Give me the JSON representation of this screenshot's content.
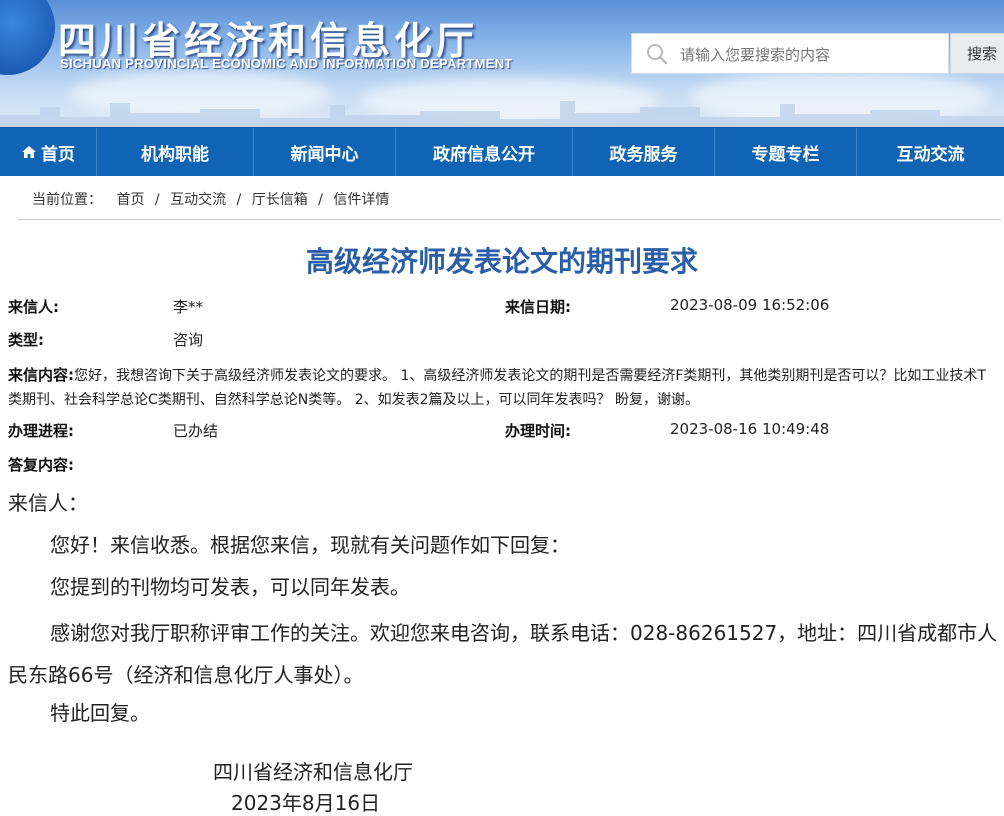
{
  "header": {
    "logo_cn": "四川省经济和信息化厅",
    "logo_en": "SICHUAN PROVINCIAL ECONOMIC AND INFORMATION DEPARTMENT",
    "search_placeholder": "请输入您要搜索的内容",
    "search_button": "搜索"
  },
  "nav": {
    "items": [
      "首页",
      "机构职能",
      "新闻中心",
      "政府信息公开",
      "政务服务",
      "专题专栏",
      "互动交流"
    ]
  },
  "breadcrumb": {
    "label": "当前位置：",
    "items": [
      "首页",
      "/",
      "互动交流",
      "/",
      "厅长信箱",
      "/",
      "信件详情"
    ]
  },
  "letter": {
    "title": "高级经济师发表论文的期刊要求",
    "sender_label": "来信人:",
    "sender": "李**",
    "date_label": "来信日期:",
    "date": "2023-08-09 16:52:06",
    "type_label": "类型:",
    "type": "咨询",
    "content_label": "来信内容:",
    "content": "您好，我想咨询下关于高级经济师发表论文的要求。 1、高级经济师发表论文的期刊是否需要经济F类期刊，其他类别期刊是否可以？比如工业技术T类期刊、社会科学总论C类期刊、自然科学总论N类等。 2、如发表2篇及以上，可以同年发表吗？ 盼复，谢谢。",
    "progress_label": "办理进程:",
    "progress": "已办结",
    "handle_time_label": "办理时间:",
    "handle_time": "2023-08-16 10:49:48",
    "reply_label": "答复内容:"
  },
  "reply": {
    "salutation": "来信人：",
    "p1": "您好！来信收悉。根据您来信，现就有关问题作如下回复：",
    "p2": "您提到的刊物均可发表，可以同年发表。",
    "p3": "感谢您对我厅职称评审工作的关注。欢迎您来电咨询，联系电话：028-86261527，地址：四川省成都市人民东路66号（经济和信息化厅人事处）。",
    "p4": "特此回复。",
    "signature": "四川省经济和信息化厅",
    "sign_date": "2023年8月16日"
  },
  "colors": {
    "nav_bg": "#1164b4",
    "title": "#2a5fa8"
  },
  "icons": {
    "search": "search-icon",
    "home": "home-icon"
  }
}
